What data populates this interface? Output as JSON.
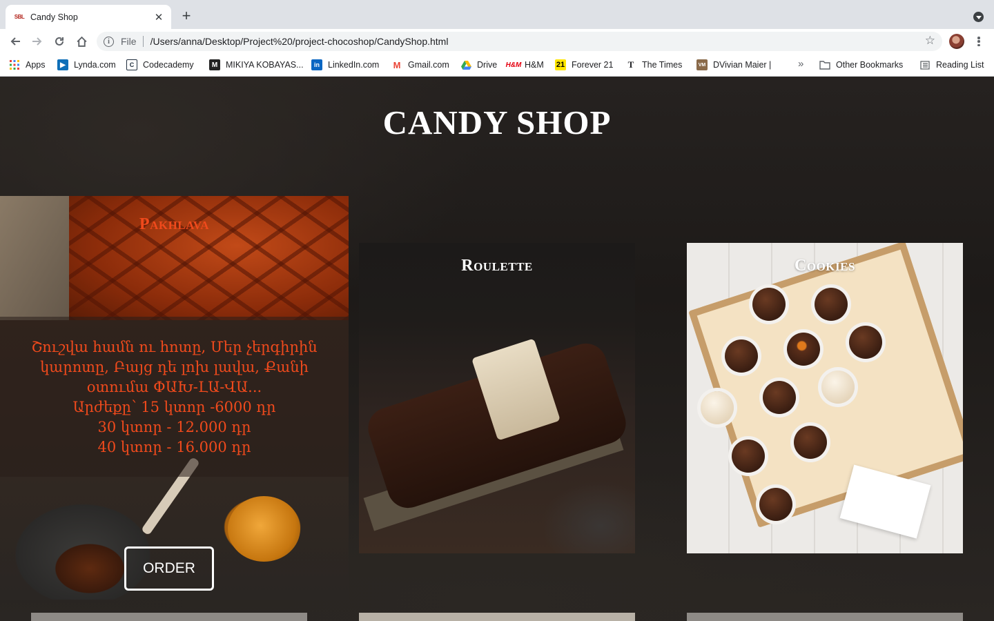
{
  "browser": {
    "tab_title": "Candy Shop",
    "favicon_text": "SBL",
    "scheme": "File",
    "url": "/Users/anna/Desktop/Project%20/project-chocoshop/CandyShop.html"
  },
  "bookmarks": {
    "items": [
      {
        "label": "Apps",
        "icon": "apps-grid-icon"
      },
      {
        "label": "Lynda.com",
        "icon": "lynda-icon"
      },
      {
        "label": "Codecademy",
        "icon": "codecademy-icon"
      },
      {
        "label": "MIKIYA KOBAYAS...",
        "icon": "m-icon"
      },
      {
        "label": "LinkedIn.com",
        "icon": "linkedin-icon"
      },
      {
        "label": "Gmail.com",
        "icon": "gmail-icon"
      },
      {
        "label": "Drive",
        "icon": "drive-icon"
      },
      {
        "label": "H&M",
        "icon": "hm-icon"
      },
      {
        "label": "Forever 21",
        "icon": "forever21-icon"
      },
      {
        "label": "The Times",
        "icon": "times-icon"
      },
      {
        "label": "DVivian Maier |",
        "icon": "vm-icon"
      }
    ],
    "overflow": "»",
    "other": "Other Bookmarks",
    "reading_list": "Reading List"
  },
  "page": {
    "title": "CANDY SHOP",
    "cards": [
      {
        "title": "Pakhlava",
        "description": [
          "Շուշվա համն ու հոտը, Մեր չերգիրին",
          "կարոտը, Բայց դե լոխ լավա, Քանի",
          "օտումա ՓԱԽ-ԼԱ-ՎԱ...",
          "Արժեքը՝ 15 կտոր -6000 դր",
          "30 կտոր - 12.000 դր",
          "40 կտոր - 16.000 դր"
        ],
        "button": "ORDER"
      },
      {
        "title": "Roulette"
      },
      {
        "title": "Cookies"
      }
    ]
  },
  "colors": {
    "accent": "#f04a1c",
    "title": "#ffffff"
  }
}
